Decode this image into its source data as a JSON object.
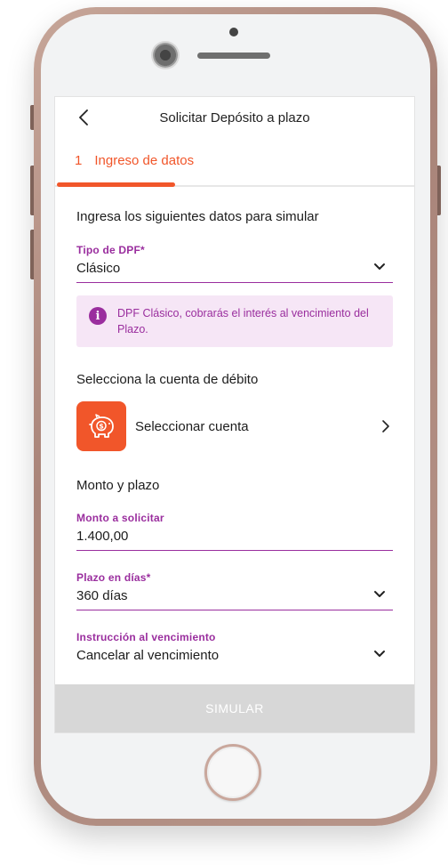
{
  "header": {
    "title": "Solicitar Depósito a plazo"
  },
  "stepper": {
    "number": "1",
    "label": "Ingreso de datos",
    "progress_fraction": 0.33
  },
  "form": {
    "intro": "Ingresa los siguientes datos para simular",
    "tipo_dpf": {
      "label": "Tipo de DPF*",
      "value": "Clásico"
    },
    "info": "DPF Clásico, cobrarás el interés al vencimiento del Plazo.",
    "cuenta_heading": "Selecciona la cuenta de débito",
    "cuenta_action": "Seleccionar cuenta",
    "monto_plazo_heading": "Monto y plazo",
    "monto": {
      "label": "Monto a solicitar",
      "value": "1.400,00"
    },
    "plazo": {
      "label": "Plazo en días*",
      "value": "360 días"
    },
    "instruccion": {
      "label": "Instrucción al vencimiento",
      "value": "Cancelar al vencimiento"
    }
  },
  "footer": {
    "simulate_label": "SIMULAR"
  },
  "icons": {
    "back": "chevron-left-icon",
    "dropdown": "chevron-down-icon",
    "info": "info-icon",
    "account": "piggy-bank-icon",
    "row_arrow": "chevron-right-icon"
  },
  "colors": {
    "accent_orange": "#f1562a",
    "accent_purple": "#9a2e9e",
    "info_background": "#f6e6f6",
    "disabled_button": "#d7d7d7"
  }
}
